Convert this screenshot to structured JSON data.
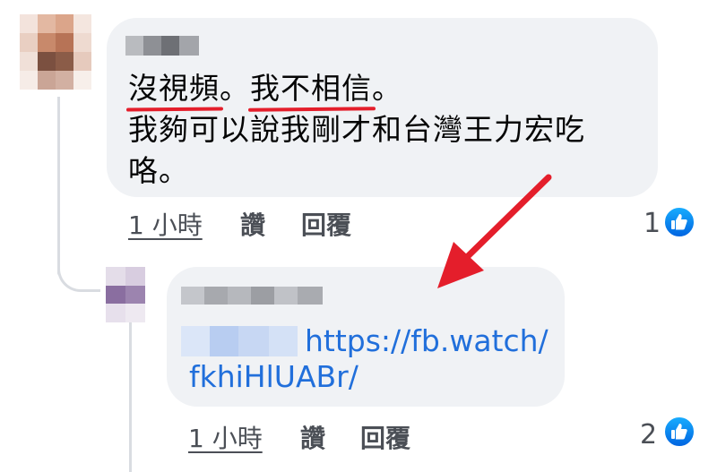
{
  "comment1": {
    "text_lines": [
      "沒視頻。我不相信。",
      "我夠可以說我剛才和台灣王力宏吃",
      "咯。"
    ],
    "highlight_a": "沒視頻",
    "punct_a": "。",
    "highlight_b": "我不相信",
    "punct_b": "。",
    "time": "1 小時",
    "like_action": "讚",
    "reply_action": "回覆",
    "reaction_count": "1"
  },
  "comment2": {
    "link_line1": "https://fb.watch/",
    "link_line2": "fkhiHlUABr/",
    "time": "1 小時",
    "like_action": "讚",
    "reply_action": "回覆",
    "reaction_count": "2"
  },
  "colors": {
    "bubble": "#f0f2f5",
    "link": "#216fdb",
    "annotation_red": "#e41e2b",
    "like_blue": "#1877f2"
  },
  "icons": [
    "like-icon",
    "red-arrow-annotation"
  ]
}
